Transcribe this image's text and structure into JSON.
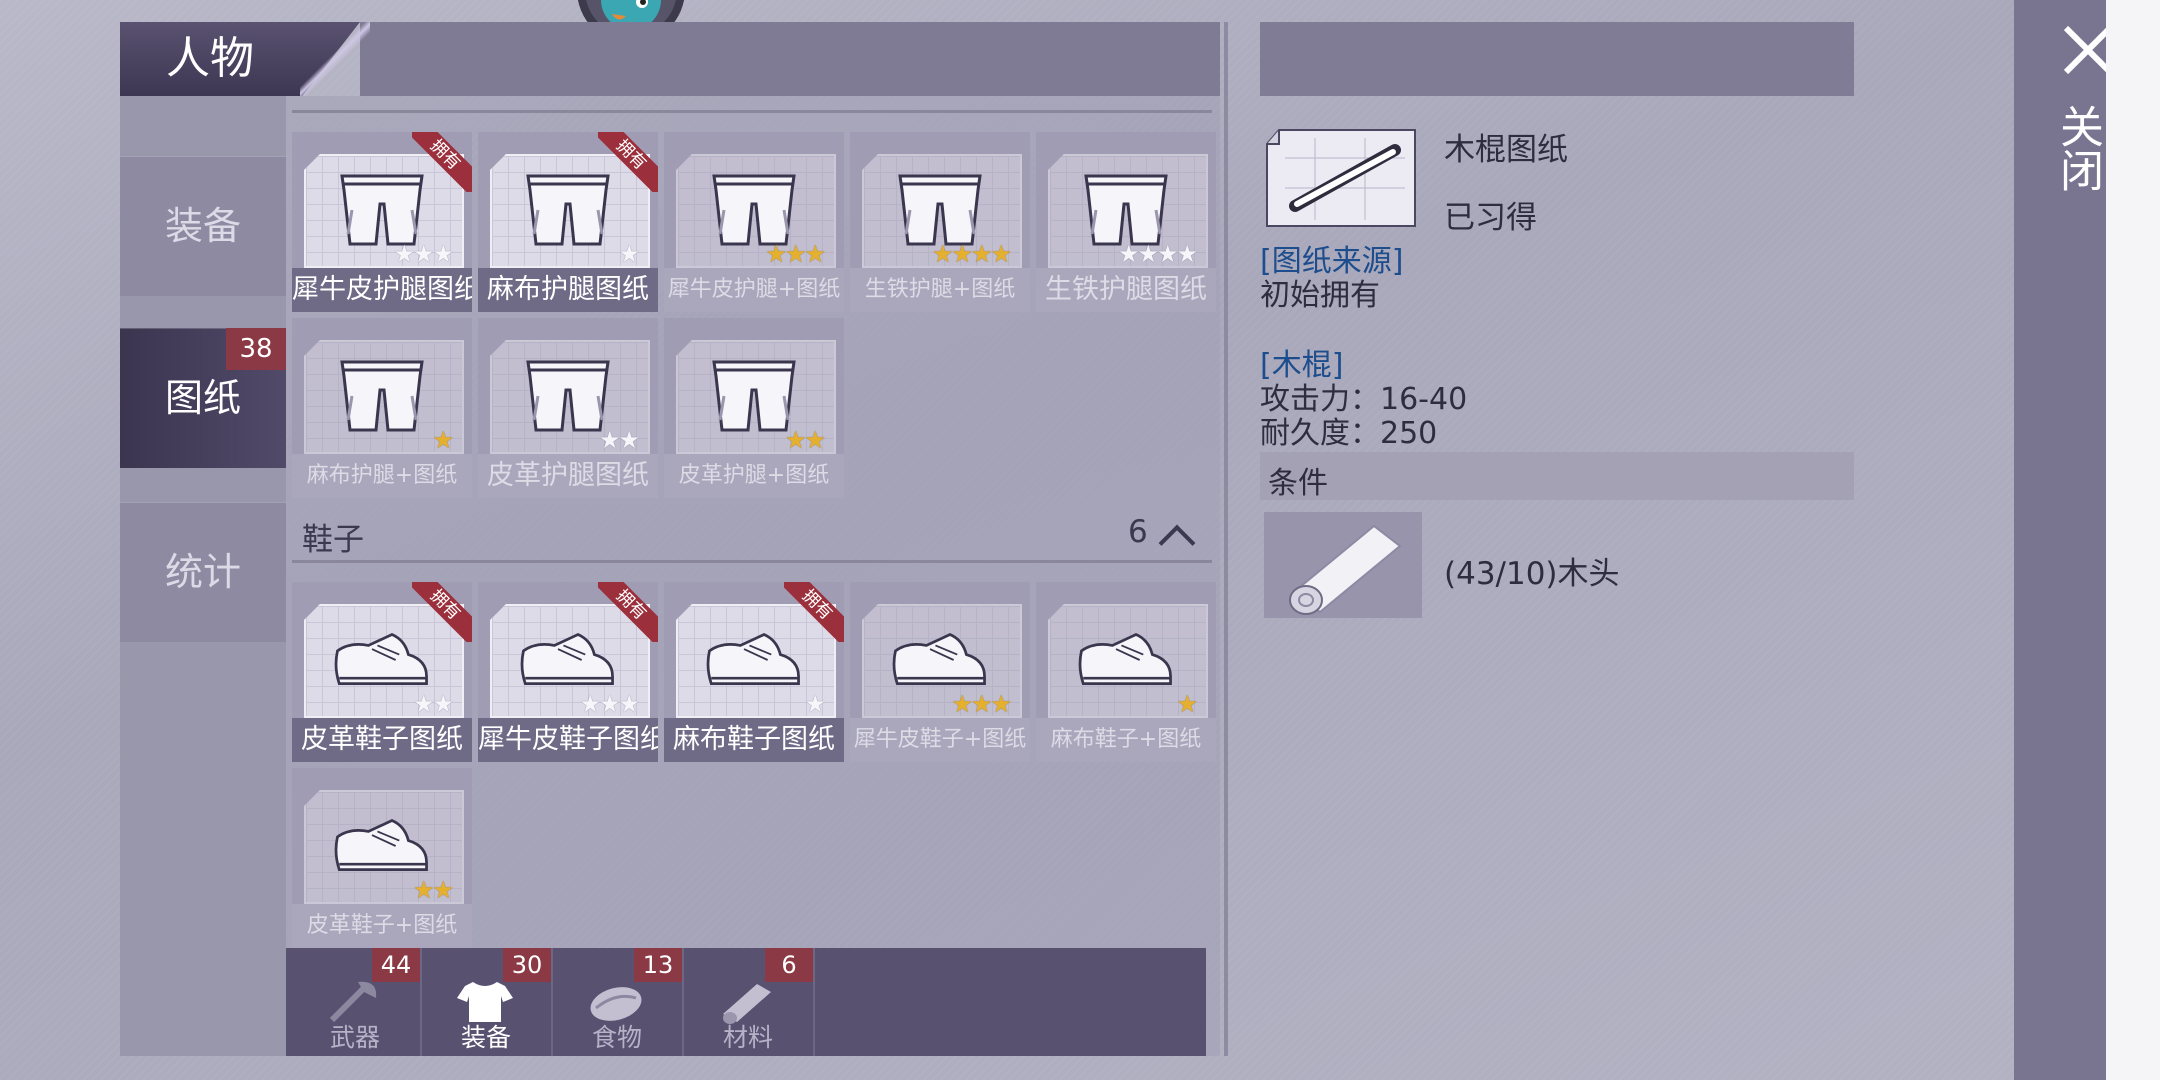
{
  "window": {
    "title": "人物",
    "close_label": "关闭"
  },
  "sidebar": {
    "tabs": [
      {
        "label": "装备"
      },
      {
        "label": "图纸",
        "badge": "38",
        "active": true
      },
      {
        "label": "统计"
      }
    ]
  },
  "leg_grid": {
    "items": [
      {
        "label": "犀牛皮护腿图纸",
        "owned": true,
        "owned_label": "拥有",
        "stars": {
          "gold": 0,
          "white": 3
        }
      },
      {
        "label": "麻布护腿图纸",
        "owned": true,
        "owned_label": "拥有",
        "stars": {
          "gold": 0,
          "white": 1
        }
      },
      {
        "label": "犀牛皮护腿+图纸",
        "owned": false,
        "stars": {
          "gold": 3,
          "white": 0
        }
      },
      {
        "label": "生铁护腿+图纸",
        "owned": false,
        "stars": {
          "gold": 4,
          "white": 0
        }
      },
      {
        "label": "生铁护腿图纸",
        "owned": false,
        "stars": {
          "gold": 0,
          "white": 4
        }
      },
      {
        "label": "麻布护腿+图纸",
        "owned": false,
        "stars": {
          "gold": 1,
          "white": 0
        }
      },
      {
        "label": "皮革护腿图纸",
        "owned": false,
        "stars": {
          "gold": 0,
          "white": 2
        }
      },
      {
        "label": "皮革护腿+图纸",
        "owned": false,
        "stars": {
          "gold": 2,
          "white": 0
        }
      }
    ]
  },
  "shoes_section": {
    "title": "鞋子",
    "count": "6",
    "items": [
      {
        "label": "皮革鞋子图纸",
        "owned": true,
        "owned_label": "拥有",
        "stars": {
          "gold": 0,
          "white": 2
        }
      },
      {
        "label": "犀牛皮鞋子图纸",
        "owned": true,
        "owned_label": "拥有",
        "stars": {
          "gold": 0,
          "white": 3
        }
      },
      {
        "label": "麻布鞋子图纸",
        "owned": true,
        "owned_label": "拥有",
        "stars": {
          "gold": 0,
          "white": 1
        }
      },
      {
        "label": "犀牛皮鞋子+图纸",
        "owned": false,
        "stars": {
          "gold": 3,
          "white": 0
        }
      },
      {
        "label": "麻布鞋子+图纸",
        "owned": false,
        "stars": {
          "gold": 1,
          "white": 0
        }
      },
      {
        "label": "皮革鞋子+图纸",
        "owned": false,
        "stars": {
          "gold": 2,
          "white": 0
        }
      }
    ]
  },
  "bottom_tabs": [
    {
      "label": "武器",
      "count": "44",
      "icon": "axe-icon"
    },
    {
      "label": "装备",
      "count": "30",
      "icon": "shirt-icon",
      "active": true
    },
    {
      "label": "食物",
      "count": "13",
      "icon": "meat-icon"
    },
    {
      "label": "材料",
      "count": "6",
      "icon": "wood-icon"
    }
  ],
  "detail": {
    "name": "木棍图纸",
    "status": "已习得",
    "source_heading": "[图纸来源]",
    "source_text": "初始拥有",
    "item_heading": "[木棍]",
    "attack": "攻击力：16-40",
    "durability": "耐久度：250",
    "condition_heading": "条件",
    "material": "(43/10)木头"
  },
  "colors": {
    "accent_red": "#8b3a45",
    "gold_star": "#e6b02f",
    "link_blue": "#1d4d8c"
  }
}
